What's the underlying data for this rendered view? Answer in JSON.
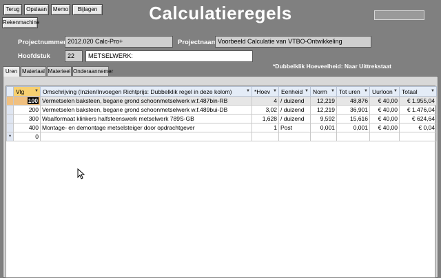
{
  "toolbar": {
    "terug": "Terug",
    "opslaan": "Opslaan",
    "memo": "Memo",
    "bijlagen": "Bijlagen",
    "rekenmachine": "Rekenmachine"
  },
  "title": "Calculatieregels",
  "form": {
    "projectnummer_label": "Projectnummer",
    "projectnummer_value": "2012.020 Calc-Pro+",
    "projectnaam_label": "Projectnaam",
    "projectnaam_value": "Voorbeeld Calculatie van VTBO-Ontwikkeling",
    "hoofdstuk_label": "Hoofdstuk",
    "hoofdstuk_number": "22",
    "hoofdstuk_name": "METSELWERK:"
  },
  "hint": "*Dubbelklik Hoeveelheid: Naar Uittrekstaat",
  "tabs": [
    "Uren",
    "Materiaal",
    "Materieel",
    "Onderaannemer"
  ],
  "table": {
    "columns": [
      "Vlg",
      "Omschrijving (Inzien/Invoegen Richtprijs: Dubbelklik regel in deze kolom)",
      "*Hoev",
      "Eenheid",
      "Norm",
      "Tot uren",
      "Uurloon",
      "Totaal"
    ],
    "rows": [
      {
        "vlg": "100",
        "oms": "Vermetselen baksteen, begane grond schoonmetselwerk w.f.487bin-RB",
        "hoev": "4",
        "eenheid": "/ duizend",
        "norm": "12,219",
        "tot_uren": "48,876",
        "uurloon": "€ 40,00",
        "totaal": "€ 1.955,04"
      },
      {
        "vlg": "200",
        "oms": "Vermetselen baksteen, begane grond schoonmetselwerk w.f.489bui-DB",
        "hoev": "3,02",
        "eenheid": "/ duizend",
        "norm": "12,219",
        "tot_uren": "36,901",
        "uurloon": "€ 40,00",
        "totaal": "€ 1.476,04"
      },
      {
        "vlg": "300",
        "oms": "Waalformaat klinkers halfsteenswerk metselwerk 789S-GB",
        "hoev": "1,628",
        "eenheid": "/ duizend",
        "norm": "9,592",
        "tot_uren": "15,616",
        "uurloon": "€ 40,00",
        "totaal": "€ 624,64"
      },
      {
        "vlg": "400",
        "oms": "Montage- en demontage metselsteiger door opdrachtgever",
        "hoev": "1",
        "eenheid": "Post",
        "norm": "0,001",
        "tot_uren": "0,001",
        "uurloon": "€ 40,00",
        "totaal": "€ 0,04"
      }
    ],
    "new_row_vlg": "0",
    "new_row_marker": "*"
  },
  "colors": {
    "background": "#808080",
    "header_bg": "#e4ecf7",
    "selected_cell": "#f0c080"
  }
}
